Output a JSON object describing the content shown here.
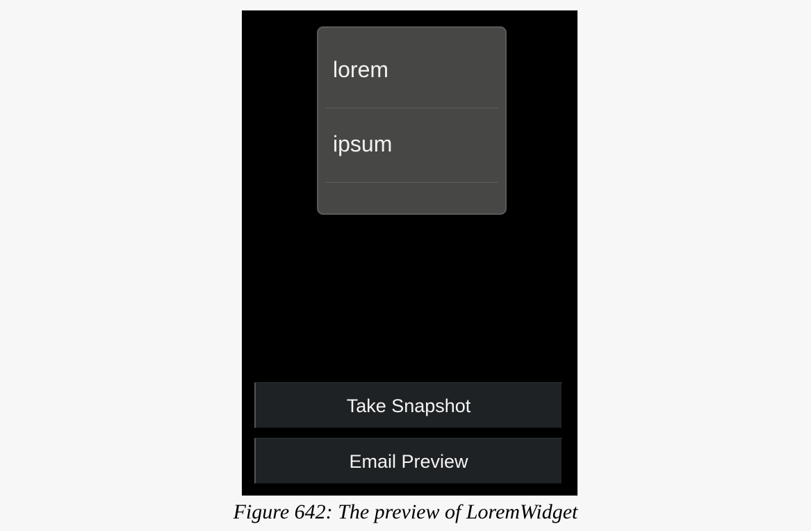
{
  "widget": {
    "items": [
      {
        "label": "lorem"
      },
      {
        "label": "ipsum"
      }
    ]
  },
  "buttons": {
    "take_snapshot": "Take Snapshot",
    "email_preview": "Email Preview"
  },
  "caption": "Figure 642: The preview of LoremWidget",
  "colors": {
    "page_background": "#f7f7f7",
    "screen_background": "#000000",
    "widget_background": "#474846",
    "button_background": "#1e2224",
    "text": "#f2f2f2"
  }
}
